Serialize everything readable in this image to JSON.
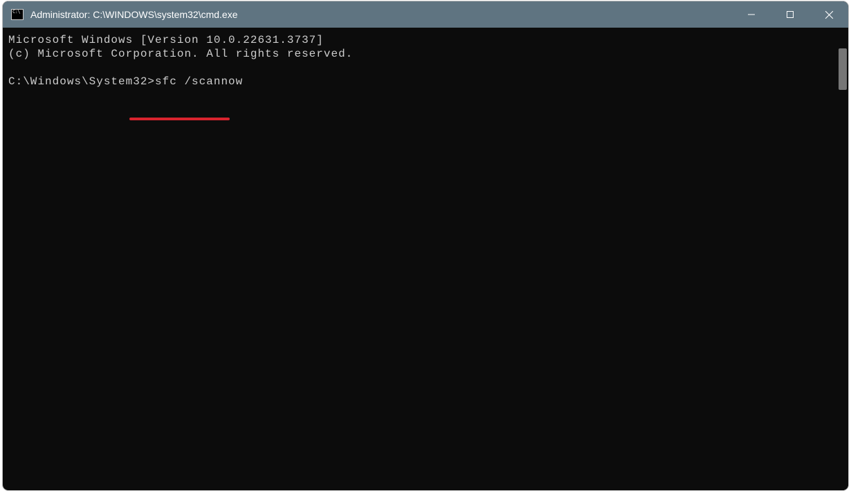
{
  "window": {
    "title": "Administrator: C:\\WINDOWS\\system32\\cmd.exe"
  },
  "console": {
    "line1": "Microsoft Windows [Version 10.0.22631.3737]",
    "line2": "(c) Microsoft Corporation. All rights reserved.",
    "blank": "",
    "prompt": "C:\\Windows\\System32>",
    "command": "sfc /scannow"
  },
  "annotation": {
    "underline_color": "#d9242e"
  }
}
